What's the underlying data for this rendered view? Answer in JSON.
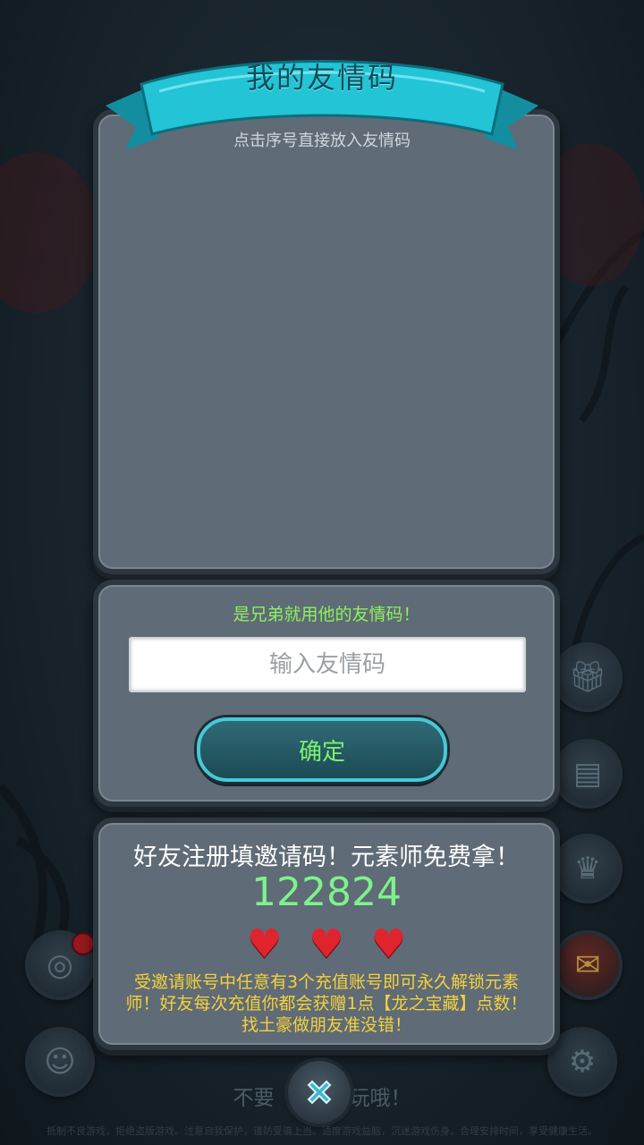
{
  "header": {
    "title": "我的友情码",
    "subtitle": "点击序号直接放入友情码"
  },
  "input_section": {
    "hint": "是兄弟就用他的友情码！",
    "placeholder": "输入友情码",
    "value": "",
    "confirm_label": "确定"
  },
  "invite_section": {
    "title": "好友注册填邀请码！元素师免费拿！",
    "code": "122824",
    "hearts": [
      "heart-icon",
      "heart-icon",
      "heart-icon"
    ],
    "description": "受邀请账号中任意有3个充值账号即可永久解锁元素师！好友每次充值你都会获赠1点【龙之宝藏】点数！找土豪做朋友准没错！"
  },
  "bottom": {
    "partial_text_left": "不要",
    "partial_text_right": "玩哦！"
  },
  "footer": {
    "notice": "抵制不良游戏，拒绝盗版游戏。注意自我保护，谨防受骗上当。适度游戏益脑，沉迷游戏伤身。合理安排时间，享受健康生活。"
  },
  "side_buttons": {
    "right": [
      "gift-icon",
      "cards-icon",
      "trophy-icon",
      "red-envelope-icon",
      "gear-icon"
    ],
    "left": [
      "dragon-icon",
      "face-icon"
    ]
  },
  "colors": {
    "panel": "#5f6b76",
    "hint_green": "#8cf25d",
    "code_green": "#7ef28a",
    "desc_yellow": "#f5d13c",
    "ribbon": "#1fb8cc"
  }
}
